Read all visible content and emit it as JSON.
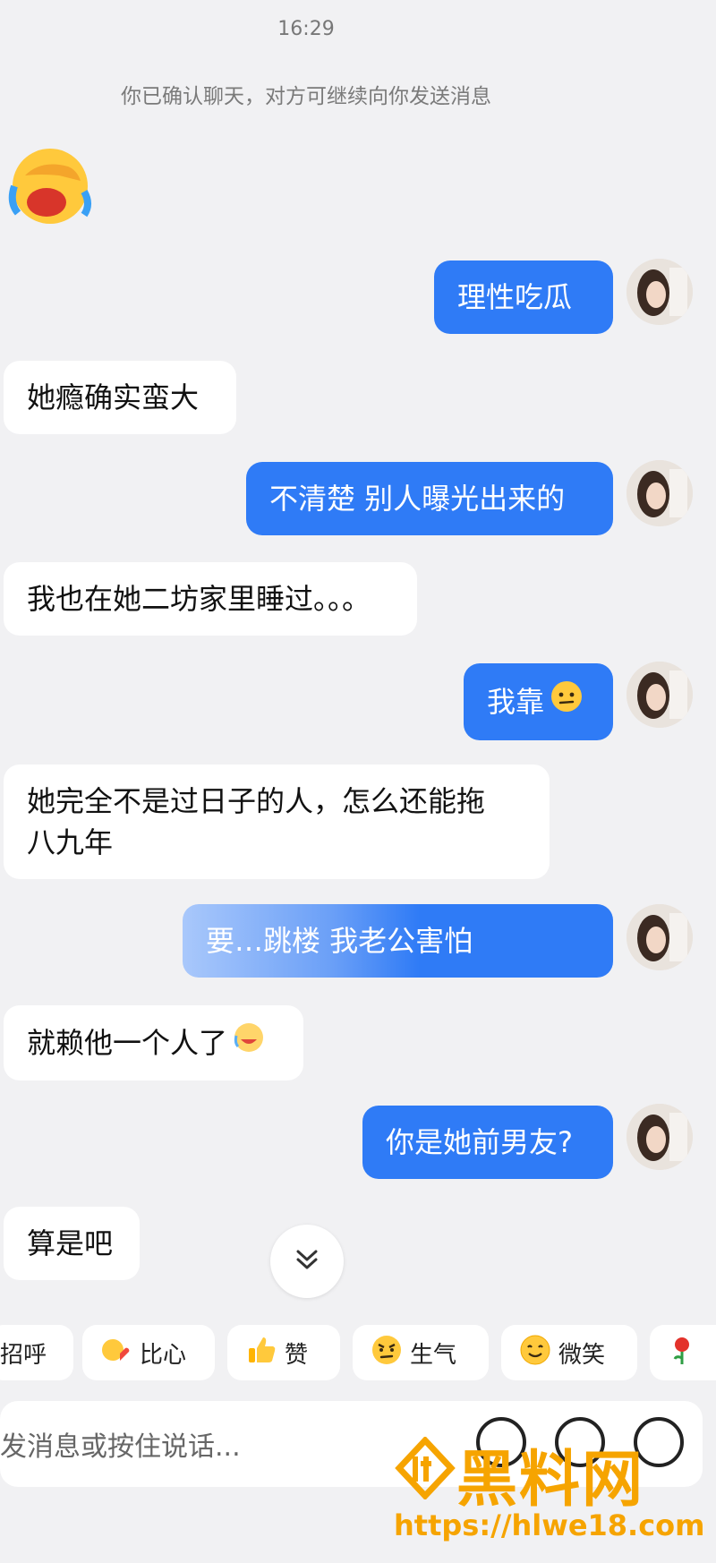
{
  "status": {
    "time": "16:29"
  },
  "system_notice": "你已确认聊天，对方可继续向你发送消息",
  "messages": [
    {
      "side": "in",
      "type": "emoji",
      "emoji": "facepalm-laugh-emoji"
    },
    {
      "side": "out",
      "text": "理性吃瓜"
    },
    {
      "side": "in",
      "text": "她瘾确实蛮大"
    },
    {
      "side": "out",
      "text": "不清楚 别人曝光出来的"
    },
    {
      "side": "in",
      "text": "我也在她二坊家里睡过。。。"
    },
    {
      "side": "out",
      "text": "我靠",
      "emoji": "awkward-face-emoji"
    },
    {
      "side": "in",
      "line1": "她完全不是过日子的人，怎么还能拖",
      "line2": "八九年"
    },
    {
      "side": "out",
      "text": "要…跳楼 我老公害怕"
    },
    {
      "side": "in",
      "text": "就赖他一个人了",
      "emoji": "laugh-cry-emoji"
    },
    {
      "side": "out",
      "text": "你是她前男友?"
    },
    {
      "side": "in",
      "text": "算是吧"
    }
  ],
  "quick_replies": [
    {
      "label": "招呼",
      "icon": "wave-icon"
    },
    {
      "label": "比心",
      "icon": "finger-heart-icon"
    },
    {
      "label": "赞",
      "icon": "thumbs-up-icon"
    },
    {
      "label": "生气",
      "icon": "angry-face-icon"
    },
    {
      "label": "微笑",
      "icon": "smile-face-icon"
    },
    {
      "label": "",
      "icon": "rose-icon"
    }
  ],
  "composer": {
    "placeholder": "发消息或按住说话..."
  },
  "watermark": {
    "title": "黑料网",
    "url": "https://hlwe18.com"
  },
  "colors": {
    "accent": "#2f7bf6",
    "background": "#f1f1f3",
    "watermark": "#f6a400"
  }
}
